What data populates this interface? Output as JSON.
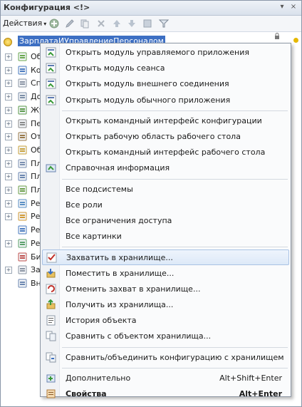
{
  "window": {
    "title": "Конфигурация <!>",
    "pin_glyph": "▾",
    "close_glyph": "×"
  },
  "toolbar": {
    "actions_label": "Действия",
    "actions_caret": "▾"
  },
  "tree": {
    "root_label": "ЗарплатаИУправлениеПерсоналом",
    "items": [
      {
        "label": "Об",
        "icon": "common-icon",
        "expander": "+"
      },
      {
        "label": "Ко",
        "icon": "constants-icon",
        "expander": "+"
      },
      {
        "label": "Сп",
        "icon": "catalogs-icon",
        "expander": "+"
      },
      {
        "label": "До",
        "icon": "documents-icon",
        "expander": "+"
      },
      {
        "label": "Жу",
        "icon": "journals-icon",
        "expander": "+"
      },
      {
        "label": "Пе",
        "icon": "enums-icon",
        "expander": "+"
      },
      {
        "label": "От",
        "icon": "reports-icon",
        "expander": "+"
      },
      {
        "label": "Об",
        "icon": "processing-icon",
        "expander": "+"
      },
      {
        "label": "Пл",
        "icon": "charts-of-characteristics-icon",
        "expander": "+"
      },
      {
        "label": "Пл",
        "icon": "charts-of-accounts-icon",
        "expander": "+"
      },
      {
        "label": "Пл",
        "icon": "charts-of-calculation-icon",
        "expander": "+"
      },
      {
        "label": "Ре",
        "icon": "info-registers-icon",
        "expander": "+"
      },
      {
        "label": "Ре",
        "icon": "accumulation-registers-icon",
        "expander": "+"
      },
      {
        "label": "Ре",
        "icon": "accounting-registers-icon",
        "expander": ""
      },
      {
        "label": "Ре",
        "icon": "calculation-registers-icon",
        "expander": "+"
      },
      {
        "label": "Би",
        "icon": "business-processes-icon",
        "expander": ""
      },
      {
        "label": "За",
        "icon": "tasks-icon",
        "expander": "+"
      },
      {
        "label": "Вн",
        "icon": "external-sources-icon",
        "expander": ""
      }
    ]
  },
  "context_menu": {
    "groups": [
      [
        {
          "label": "Открыть модуль управляемого приложения",
          "icon": "module-icon"
        },
        {
          "label": "Открыть модуль сеанса",
          "icon": "module-icon"
        },
        {
          "label": "Открыть модуль внешнего соединения",
          "icon": "module-icon"
        },
        {
          "label": "Открыть модуль обычного приложения",
          "icon": "module-icon"
        }
      ],
      [
        {
          "label": "Открыть командный интерфейс конфигурации",
          "icon": ""
        },
        {
          "label": "Открыть рабочую область рабочего стола",
          "icon": ""
        },
        {
          "label": "Открыть командный интерфейс рабочего стола",
          "icon": ""
        },
        {
          "label": "Справочная информация",
          "icon": "help-info-icon"
        }
      ],
      [
        {
          "label": "Все подсистемы",
          "icon": ""
        },
        {
          "label": "Все роли",
          "icon": ""
        },
        {
          "label": "Все ограничения доступа",
          "icon": ""
        },
        {
          "label": "Все картинки",
          "icon": ""
        }
      ],
      [
        {
          "label": "Захватить в хранилище...",
          "icon": "checkmark-icon",
          "highlighted": true
        },
        {
          "label": "Поместить в хранилище...",
          "icon": "put-to-repo-icon"
        },
        {
          "label": "Отменить захват в хранилище...",
          "icon": "undo-capture-icon"
        },
        {
          "label": "Получить из хранилища...",
          "icon": "get-from-repo-icon"
        },
        {
          "label": "История объекта",
          "icon": "history-icon"
        },
        {
          "label": "Сравнить с объектом хранилища...",
          "icon": "compare-icon"
        }
      ],
      [
        {
          "label": "Сравнить/объединить конфигурацию с хранилищем",
          "icon": "merge-icon"
        }
      ],
      [
        {
          "label": "Дополнительно",
          "icon": "additional-icon",
          "accel": "Alt+Shift+Enter"
        },
        {
          "label": "Свойства",
          "icon": "properties-icon",
          "accel": "Alt+Enter",
          "bold": true
        }
      ]
    ]
  },
  "colors": {
    "selection": "#3d6fc3",
    "menu_highlight": "#dde9f8",
    "menu_border": "#8c96a4"
  }
}
